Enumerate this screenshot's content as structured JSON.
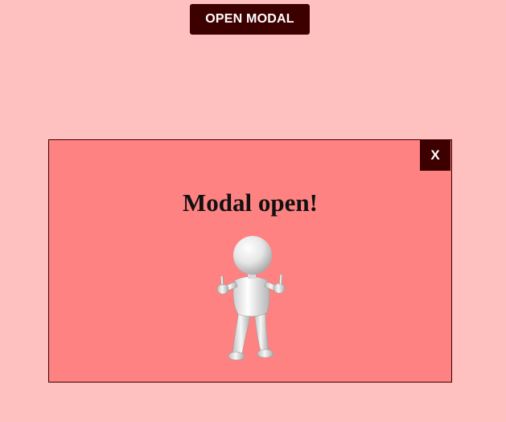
{
  "page": {
    "background_color": "#ffc0c0",
    "open_button_label": "OPEN MODAL"
  },
  "modal": {
    "background_color": "#ff8282",
    "close_label": "X",
    "title": "Modal open!",
    "image": {
      "icon": "thumbs-up-3d-person-icon"
    }
  }
}
